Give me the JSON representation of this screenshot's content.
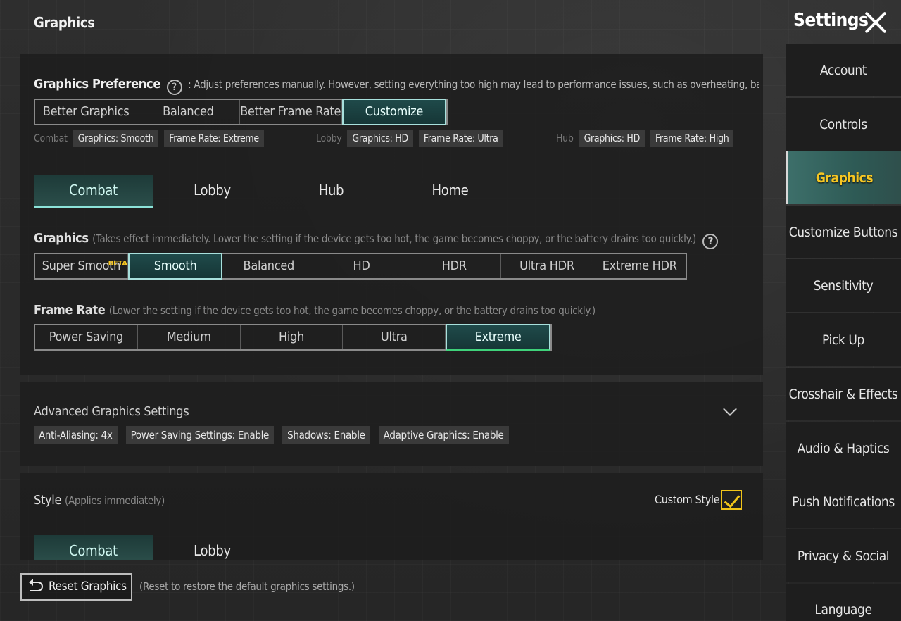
{
  "header": {
    "page_title": "Graphics",
    "settings_title": "Settings"
  },
  "preference": {
    "label": "Graphics Preference",
    "description": ": Adjust preferences manually. However, setting everything too high may lead to performance issues, such as overheating, bat",
    "options": [
      "Better Graphics",
      "Balanced",
      "Better Frame Rate",
      "Customize"
    ],
    "selected": "Customize",
    "summary": [
      {
        "label": "Combat",
        "graphics": "Graphics: Smooth",
        "frame_rate": "Frame Rate: Extreme"
      },
      {
        "label": "Lobby",
        "graphics": "Graphics: HD",
        "frame_rate": "Frame Rate: Ultra"
      },
      {
        "label": "Hub",
        "graphics": "Graphics: HD",
        "frame_rate": "Frame Rate: High"
      }
    ]
  },
  "mode_tabs": [
    "Combat",
    "Lobby",
    "Hub",
    "Home"
  ],
  "graphics_quality": {
    "label": "Graphics",
    "note": "(Takes effect immediately. Lower the setting if the device gets too hot, the game becomes choppy, or the battery drains too quickly.)",
    "options": [
      "Super Smooth",
      "Smooth",
      "Balanced",
      "HD",
      "HDR",
      "Ultra HDR",
      "Extreme HDR"
    ],
    "beta_badge": "BETA",
    "selected": "Smooth"
  },
  "frame_rate": {
    "label": "Frame Rate",
    "note": "(Lower the setting if the device gets too hot, the game becomes choppy, or the battery drains too quickly.)",
    "options": [
      "Power Saving",
      "Medium",
      "High",
      "Ultra",
      "Extreme"
    ],
    "selected": "Extreme"
  },
  "advanced": {
    "title": "Advanced Graphics Settings",
    "chips": [
      "Anti-Aliasing: 4x",
      "Power Saving Settings: Enable",
      "Shadows: Enable",
      "Adaptive Graphics: Enable"
    ],
    "expand_icon": "chevron-down-icon"
  },
  "style": {
    "label": "Style",
    "note": "(Applies immediately)",
    "custom_style_label": "Custom Style",
    "custom_style_checked": true,
    "tabs": [
      "Combat",
      "Lobby"
    ]
  },
  "reset": {
    "button_label": "Reset Graphics",
    "note": "(Reset to restore the default graphics settings.)"
  },
  "sidebar": {
    "items": [
      "Account",
      "Controls",
      "Graphics",
      "Customize Buttons",
      "Sensitivity",
      "Pick Up",
      "Crosshair & Effects",
      "Audio & Haptics",
      "Push Notifications",
      "Privacy & Social",
      "Language"
    ],
    "active": "Graphics"
  },
  "colors": {
    "accent_teal": "#a8e0dc",
    "active_text_yellow": "#f5c623",
    "checkbox_yellow": "#f0c419"
  }
}
